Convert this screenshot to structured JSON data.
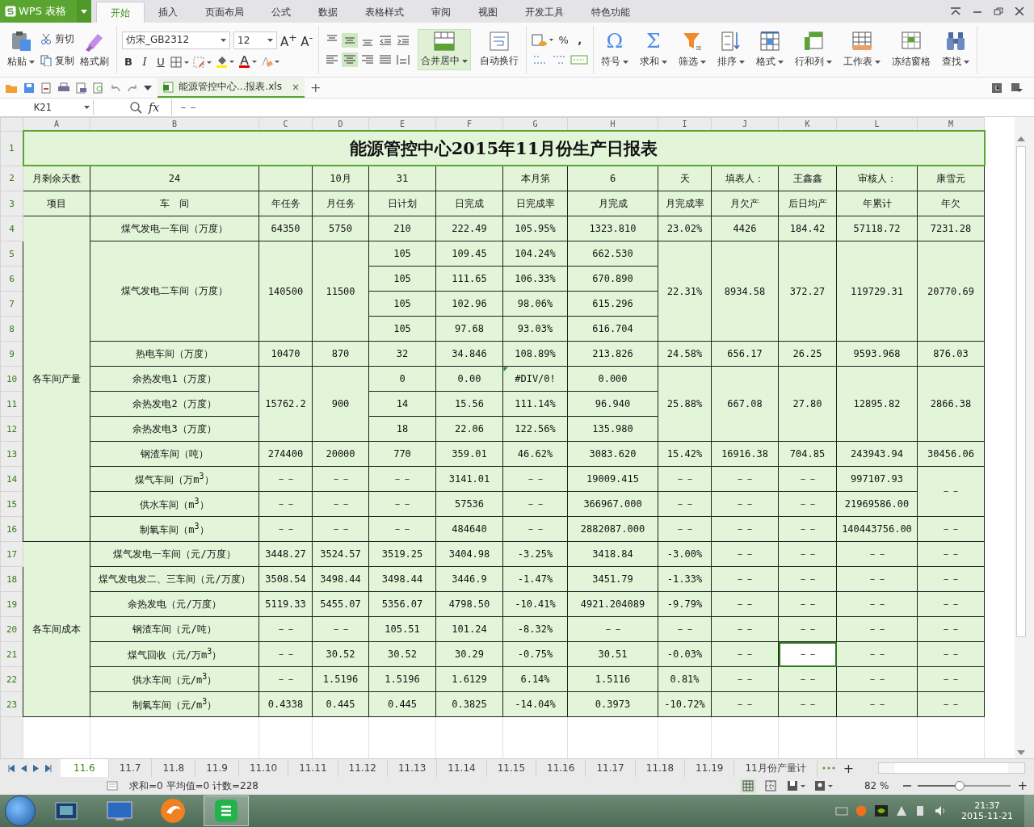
{
  "app": {
    "name": "WPS 表格"
  },
  "tabs": [
    {
      "label": "开始",
      "selected": true
    },
    {
      "label": "插入",
      "selected": false
    },
    {
      "label": "页面布局",
      "selected": false
    },
    {
      "label": "公式",
      "selected": false
    },
    {
      "label": "数据",
      "selected": false
    },
    {
      "label": "表格样式",
      "selected": false
    },
    {
      "label": "审阅",
      "selected": false
    },
    {
      "label": "视图",
      "selected": false
    },
    {
      "label": "开发工具",
      "selected": false
    },
    {
      "label": "特色功能",
      "selected": false
    }
  ],
  "ribbon": {
    "clipboard": {
      "paste": "粘贴",
      "cut": "剪切",
      "copy": "复制",
      "format_painter": "格式刷"
    },
    "font": {
      "name": "仿宋_GB2312",
      "size": "12",
      "grow": "A$^{+}$",
      "shrink": "A$^{-}$",
      "bold": "B",
      "italic": "I",
      "underline": "U"
    },
    "align": [
      {
        "kind": "top",
        "selected": false
      },
      {
        "kind": "middle",
        "selected": true
      },
      {
        "kind": "bottom",
        "selected": false
      },
      {
        "kind": "left",
        "selected": false
      },
      {
        "kind": "center",
        "selected": true
      },
      {
        "kind": "right",
        "selected": false
      },
      {
        "kind": "justify",
        "selected": false
      },
      {
        "kind": "distributed",
        "selected": false
      }
    ],
    "merge": {
      "label": "合并居中",
      "selected": true
    },
    "wrap": "自动换行",
    "number": {
      "percent": "%",
      "comma": ","
    },
    "tools": [
      {
        "label": "符号",
        "kind": "glyph",
        "glyph": "Ω",
        "dropdown": true
      },
      {
        "label": "求和",
        "kind": "glyph",
        "glyph": "Σ",
        "dropdown": true
      },
      {
        "label": "筛选",
        "kind": "filter",
        "dropdown": true
      },
      {
        "label": "排序",
        "kind": "sort",
        "dropdown": true
      },
      {
        "label": "格式",
        "kind": "grid",
        "dropdown": true
      },
      {
        "label": "行和列",
        "kind": "rows",
        "dropdown": true
      },
      {
        "label": "工作表",
        "kind": "sheet",
        "dropdown": true
      },
      {
        "label": "冻结窗格",
        "kind": "freeze",
        "dropdown": false
      },
      {
        "label": "查找",
        "kind": "binoculars",
        "dropdown": true
      }
    ]
  },
  "document_tab": {
    "title": "能源管控中心...报表.xls",
    "close": "×",
    "new": "+"
  },
  "formula_bar": {
    "cell": "K21",
    "fx": "fx",
    "value": "－－"
  },
  "sheet": {
    "columns": [
      "A",
      "B",
      "C",
      "D",
      "E",
      "F",
      "G",
      "H",
      "I",
      "J",
      "K",
      "L",
      "M"
    ],
    "rows": [
      {
        "number": "1",
        "kind": "title",
        "cells": [
          {
            "text": "能源管控中心2015年11月份生产日报表",
            "colspan": 13
          }
        ]
      },
      {
        "number": "2",
        "kind": "data",
        "cells": [
          "月剩余天数",
          "24",
          null,
          "10月",
          "31",
          null,
          "本月第",
          "6",
          "天",
          "填表人：",
          "王鑫鑫",
          "审核人：",
          "康雪元"
        ]
      },
      {
        "number": "3",
        "kind": "data",
        "cells": [
          "项目",
          "车　间",
          "年任务",
          "月任务",
          "日计划",
          "日完成",
          "日完成率",
          "月完成",
          "月完成率",
          "月欠产",
          "后日均产",
          "年累计",
          "年欠"
        ]
      },
      {
        "number": "4",
        "kind": "data",
        "cells": [
          {
            "text": "各车间产量",
            "rowspan": 13
          },
          "煤气发电一车间（万度）",
          "64350",
          "5750",
          "210",
          "222.49",
          "105.95%",
          "1323.810",
          "23.02%",
          "4426",
          "184.42",
          "57118.72",
          "7231.28"
        ]
      },
      {
        "number": "5",
        "kind": "data",
        "cells": [
          {
            "text": "煤气发电二车间（万度）",
            "rowspan": 4
          },
          {
            "text": "140500",
            "rowspan": 4
          },
          {
            "text": "11500",
            "rowspan": 4
          },
          "105",
          "109.45",
          "104.24%",
          "662.530",
          {
            "text": "22.31%",
            "rowspan": 4
          },
          {
            "text": "8934.58",
            "rowspan": 4
          },
          {
            "text": "372.27",
            "rowspan": 4
          },
          {
            "text": "119729.31",
            "rowspan": 4
          },
          {
            "text": "20770.69",
            "rowspan": 4
          }
        ]
      },
      {
        "number": "6",
        "kind": "data",
        "cells": [
          "105",
          "111.65",
          "106.33%",
          "670.890"
        ]
      },
      {
        "number": "7",
        "kind": "data",
        "cells": [
          "105",
          "102.96",
          "98.06%",
          "615.296"
        ]
      },
      {
        "number": "8",
        "kind": "data",
        "cells": [
          "105",
          "97.68",
          "93.03%",
          "616.704"
        ]
      },
      {
        "number": "9",
        "kind": "data",
        "cells": [
          "热电车间（万度）",
          "10470",
          "870",
          "32",
          "34.846",
          "108.89%",
          "213.826",
          "24.58%",
          "656.17",
          "26.25",
          "9593.968",
          "876.03"
        ]
      },
      {
        "number": "10",
        "kind": "data",
        "cells": [
          "余热发电1（万度）",
          {
            "text": "15762.2",
            "rowspan": 3
          },
          {
            "text": "900",
            "rowspan": 3
          },
          "0",
          "0.00",
          {
            "text": "#DIV/0!",
            "error_mark": true
          },
          "0.000",
          {
            "text": "25.88%",
            "rowspan": 3
          },
          {
            "text": "667.08",
            "rowspan": 3
          },
          {
            "text": "27.80",
            "rowspan": 3
          },
          {
            "text": "12895.82",
            "rowspan": 3
          },
          {
            "text": "2866.38",
            "rowspan": 3
          }
        ]
      },
      {
        "number": "11",
        "kind": "data",
        "cells": [
          "余热发电2（万度）",
          "14",
          "15.56",
          "111.14%",
          "96.940"
        ]
      },
      {
        "number": "12",
        "kind": "data",
        "cells": [
          "余热发电3（万度）",
          "18",
          "22.06",
          "122.56%",
          "135.980"
        ]
      },
      {
        "number": "13",
        "kind": "data",
        "cells": [
          "钢渣车间（吨）",
          "274400",
          "20000",
          "770",
          "359.01",
          "46.62%",
          "3083.620",
          "15.42%",
          "16916.38",
          "704.85",
          "243943.94",
          "30456.06"
        ]
      },
      {
        "number": "14",
        "kind": "data",
        "cells": [
          "煤气车间（万m$^{3}$）",
          "－－",
          "－－",
          "－－",
          "3141.01",
          "－－",
          "19009.415",
          "－－",
          "－－",
          "－－",
          "997107.93",
          {
            "text": "－－",
            "rowspan": 2
          }
        ]
      },
      {
        "number": "15",
        "kind": "data",
        "cells": [
          "供水车间（m$^{3}$）",
          "－－",
          "－－",
          "－－",
          "57536",
          "－－",
          "366967.000",
          "－－",
          "－－",
          "－－",
          "21969586.00"
        ]
      },
      {
        "number": "16",
        "kind": "data",
        "cells": [
          "制氧车间（m$^{3}$）",
          "－－",
          "－－",
          "－－",
          "484640",
          "－－",
          "2882087.000",
          "－－",
          "－－",
          "－－",
          "140443756.00",
          "－－"
        ]
      },
      {
        "number": "17",
        "kind": "data",
        "cells": [
          {
            "text": "各车间成本",
            "rowspan": 7
          },
          "煤气发电一车间（元/万度）",
          "3448.27",
          "3524.57",
          "3519.25",
          "3404.98",
          "-3.25%",
          "3418.84",
          "-3.00%",
          "－－",
          "－－",
          "－－",
          "－－"
        ]
      },
      {
        "number": "18",
        "kind": "data",
        "cells": [
          "煤气发电发二、三车间（元/万度）",
          "3508.54",
          "3498.44",
          "3498.44",
          "3446.9",
          "-1.47%",
          "3451.79",
          "-1.33%",
          "－－",
          "－－",
          "－－",
          "－－"
        ]
      },
      {
        "number": "19",
        "kind": "data",
        "cells": [
          "余热发电（元/万度）",
          "5119.33",
          "5455.07",
          "5356.07",
          "4798.50",
          "-10.41%",
          "4921.204089",
          "-9.79%",
          "－－",
          "－－",
          "－－",
          "－－"
        ]
      },
      {
        "number": "20",
        "kind": "data",
        "cells": [
          "钢渣车间（元/吨）",
          "－－",
          "－－",
          "105.51",
          "101.24",
          "-8.32%",
          "－－",
          "－－",
          "－－",
          "－－",
          "－－",
          "－－"
        ]
      },
      {
        "number": "21",
        "kind": "data",
        "cells": [
          "煤气回收（元/万m$^{3}$）",
          "－－",
          "30.52",
          "30.52",
          "30.29",
          "-0.75%",
          "30.51",
          "-0.03%",
          "－－",
          {
            "text": "－－",
            "selected": true
          },
          "－－",
          "－－"
        ]
      },
      {
        "number": "22",
        "kind": "data",
        "cells": [
          "供水车间（元/m$^{3}$）",
          "－－",
          "1.5196",
          "1.5196",
          "1.6129",
          "6.14%",
          "1.5116",
          "0.81%",
          "－－",
          "－－",
          "－－",
          "－－"
        ]
      },
      {
        "number": "23",
        "kind": "data",
        "cells": [
          "制氧车间（元/m$^{3}$）",
          "0.4338",
          "0.445",
          "0.445",
          "0.3825",
          "-14.04%",
          "0.3973",
          "-10.72%",
          "－－",
          "－－",
          "－－",
          "－－"
        ]
      }
    ]
  },
  "sheet_tabs": [
    {
      "label": "11.6",
      "selected": true
    },
    {
      "label": "11.7",
      "selected": false
    },
    {
      "label": "11.8",
      "selected": false
    },
    {
      "label": "11.9",
      "selected": false
    },
    {
      "label": "11.10",
      "selected": false
    },
    {
      "label": "11.11",
      "selected": false
    },
    {
      "label": "11.12",
      "selected": false
    },
    {
      "label": "11.13",
      "selected": false
    },
    {
      "label": "11.14",
      "selected": false
    },
    {
      "label": "11.15",
      "selected": false
    },
    {
      "label": "11.16",
      "selected": false
    },
    {
      "label": "11.17",
      "selected": false
    },
    {
      "label": "11.18",
      "selected": false
    },
    {
      "label": "11.19",
      "selected": false
    },
    {
      "label": "11月份产量计",
      "selected": false
    }
  ],
  "add_sheet": "+",
  "status_bar": {
    "stats": "求和=0 平均值=0 计数=228",
    "zoom": "82 %",
    "zoom_in": "+",
    "level": 0.45
  },
  "taskbar": {
    "time": "21:37",
    "date": "2015-11-21"
  }
}
